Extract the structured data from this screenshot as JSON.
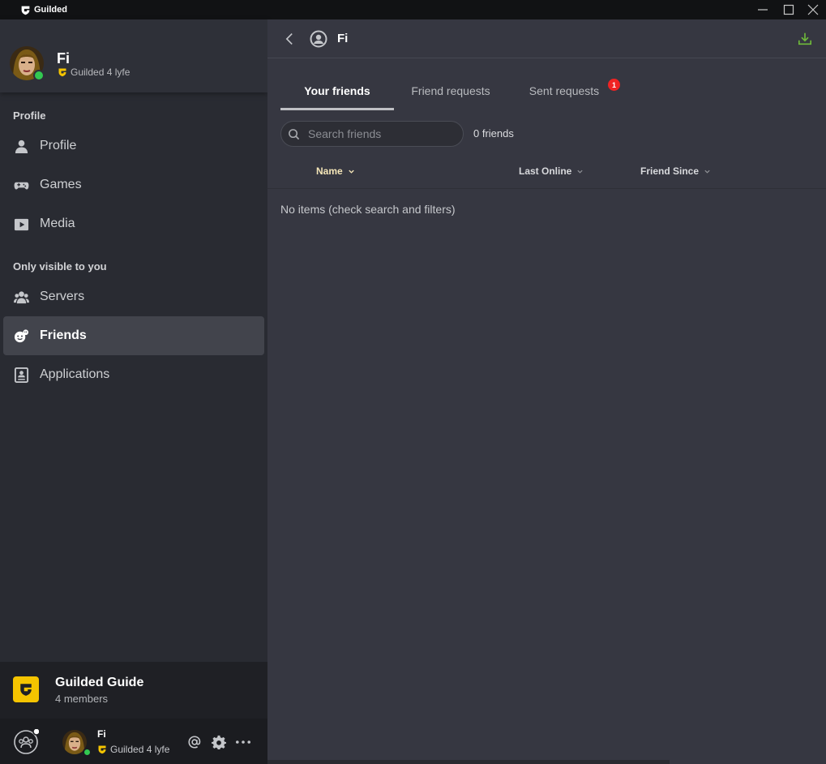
{
  "titlebar": {
    "app_name": "Guilded"
  },
  "sidebar": {
    "user": {
      "name": "Fi",
      "tagline": "Guilded 4 lyfe"
    },
    "sections": [
      {
        "label": "Profile"
      },
      {
        "label": "Only visible to you"
      }
    ],
    "items": [
      {
        "label": "Profile",
        "icon": "person-icon"
      },
      {
        "label": "Games",
        "icon": "gamepad-icon"
      },
      {
        "label": "Media",
        "icon": "play-icon"
      },
      {
        "label": "Servers",
        "icon": "people-icon"
      },
      {
        "label": "Friends",
        "icon": "friends-icon",
        "active": true
      },
      {
        "label": "Applications",
        "icon": "applications-icon"
      }
    ],
    "server": {
      "name": "Guilded Guide",
      "members": "4 members"
    },
    "bottom_user": {
      "name": "Fi",
      "tagline": "Guilded 4 lyfe"
    }
  },
  "main": {
    "header": {
      "title": "Fi"
    },
    "tabs": [
      {
        "label": "Your friends",
        "active": true
      },
      {
        "label": "Friend requests"
      },
      {
        "label": "Sent requests",
        "badge": "1"
      }
    ],
    "search": {
      "placeholder": "Search friends",
      "value": ""
    },
    "friend_count": "0 friends",
    "columns": [
      {
        "label": "Name",
        "sorted": true
      },
      {
        "label": "Last Online"
      },
      {
        "label": "Friend Since"
      }
    ],
    "empty_message": "No items (check search and filters)"
  },
  "colors": {
    "online": "#32c951",
    "brand_yellow": "#f5c400",
    "badge_red": "#f02323",
    "sorted_column": "#f5e6b8",
    "download_green": "#6fba3a"
  }
}
